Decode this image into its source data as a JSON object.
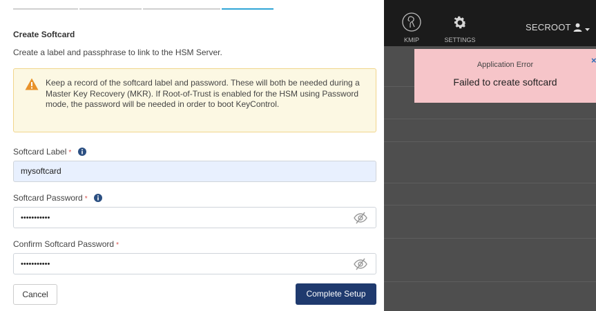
{
  "topbar": {
    "nav": [
      {
        "label": "KMIP",
        "icon": "kmip-icon"
      },
      {
        "label": "SETTINGS",
        "icon": "gear-icon"
      }
    ],
    "user": {
      "name": "SECROOT",
      "icon": "user-icon"
    }
  },
  "toast": {
    "title": "Application Error",
    "message": "Failed to create softcard",
    "close_glyph": "×",
    "color": "#f6c5c9"
  },
  "wizard": {
    "steps_active_index": 3,
    "title": "Create Softcard",
    "subtitle": "Create a label and passphrase to link to the HSM Server.",
    "warning": "Keep a record of the softcard label and password. These will both be needed during a Master Key Recovery (MKR). If Root-of-Trust is enabled for the HSM using Password mode, the password will be needed in order to boot KeyControl.",
    "fields": {
      "label": {
        "label": "Softcard Label",
        "required": "*",
        "value": "mysoftcard"
      },
      "password": {
        "label": "Softcard Password",
        "required": "*",
        "value": "•••••••••••"
      },
      "confirm": {
        "label": "Confirm Softcard Password",
        "required": "*",
        "value": "•••••••••••"
      }
    },
    "buttons": {
      "cancel": "Cancel",
      "complete": "Complete Setup"
    },
    "colors": {
      "primary": "#1f3a6e",
      "warning_bg": "#fcf8e3",
      "step_active": "#2fa5d6"
    }
  }
}
